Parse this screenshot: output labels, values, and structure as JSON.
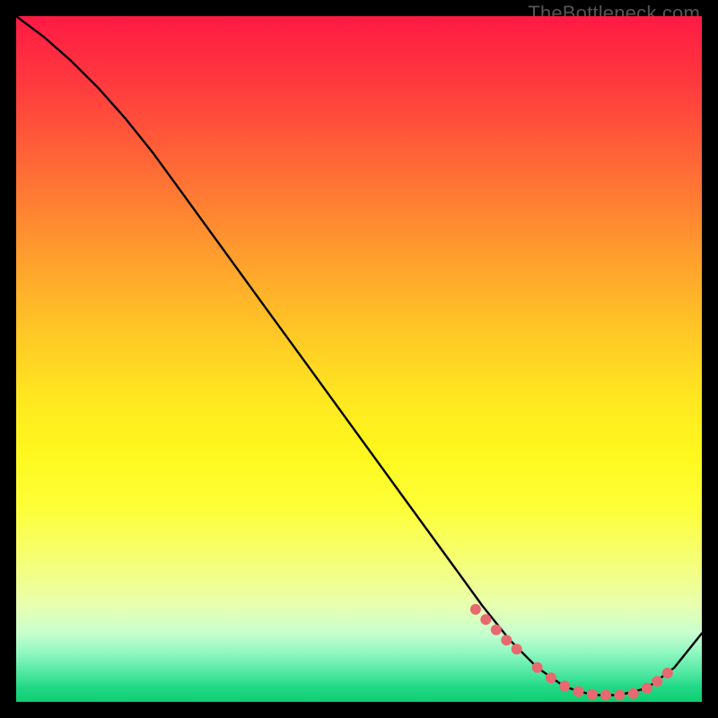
{
  "watermark": "TheBottleneck.com",
  "chart_data": {
    "type": "line",
    "title": "",
    "xlabel": "",
    "ylabel": "",
    "xlim": [
      0,
      100
    ],
    "ylim": [
      0,
      100
    ],
    "grid": false,
    "legend": false,
    "series": [
      {
        "name": "bottleneck-curve",
        "color": "#000000",
        "x": [
          0,
          4,
          8,
          12,
          16,
          20,
          24,
          28,
          32,
          36,
          40,
          44,
          48,
          52,
          56,
          60,
          64,
          68,
          72,
          76,
          80,
          84,
          88,
          92,
          96,
          100
        ],
        "y": [
          100,
          97,
          93.5,
          89.5,
          85,
          80,
          74.5,
          69,
          63.5,
          58,
          52.5,
          47,
          41.5,
          36,
          30.5,
          25,
          19.5,
          14,
          9,
          5,
          2.2,
          1,
          1,
          2,
          5,
          10
        ]
      },
      {
        "name": "highlight-points",
        "color": "#e8696f",
        "type": "scatter",
        "x": [
          67,
          68.5,
          70,
          71.5,
          73,
          76,
          78,
          80,
          82,
          84,
          86,
          88,
          90,
          92,
          93.5,
          95
        ],
        "y": [
          13.5,
          12,
          10.5,
          9,
          7.7,
          5,
          3.5,
          2.3,
          1.5,
          1.1,
          1,
          1,
          1.2,
          2,
          3,
          4.2
        ]
      }
    ]
  }
}
